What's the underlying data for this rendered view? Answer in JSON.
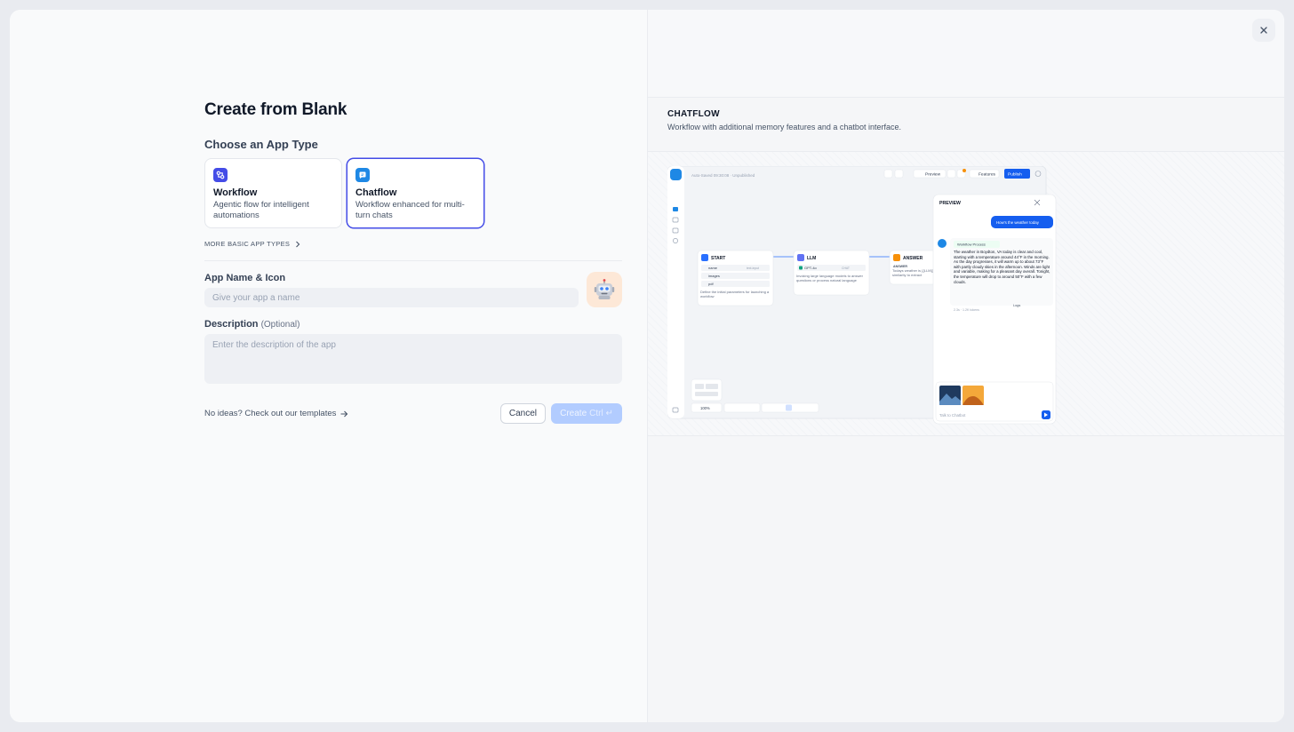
{
  "form": {
    "title": "Create from Blank",
    "app_type_label": "Choose an App Type",
    "types": [
      {
        "name": "Workflow",
        "desc": "Agentic flow for intelligent automations",
        "selected": false
      },
      {
        "name": "Chatflow",
        "desc": "Workflow enhanced for multi-turn chats",
        "selected": true
      }
    ],
    "more_types": "MORE BASIC APP TYPES",
    "name_label": "App Name & Icon",
    "name_placeholder": "Give your app a name",
    "app_icon": "🤖",
    "desc_label": "Description",
    "desc_optional": "(Optional)",
    "desc_placeholder": "Enter the description of the app",
    "templates_link": "No ideas? Check out our templates",
    "cancel_label": "Cancel",
    "create_label": "Create",
    "create_shortcut": "Ctrl ↵"
  },
  "preview": {
    "title": "CHATFLOW",
    "description": "Workflow with additional memory features and a chatbot interface.",
    "canvas": {
      "autosave": "Auto-Saved 09:30:08 · Unpublished",
      "preview_btn": "Preview",
      "features_btn": "Features",
      "publish_btn": "Publish",
      "zoom": "100%",
      "nodes": [
        {
          "title": "START",
          "rows": [
            "name",
            "images",
            "pdf"
          ],
          "row_tags": [
            "text-input"
          ],
          "desc": "Define the initial parameters for launching a workflow"
        },
        {
          "title": "LLM",
          "model": "GPT-4o",
          "model_tag": "CHAT",
          "desc": "Invoking large language models to answer questions or process natural language"
        },
        {
          "title": "ANSWER",
          "label": "ANSWER",
          "desc": "Todays weather is {{LLM}}, similarity to extract"
        }
      ],
      "chat": {
        "header": "PREVIEW",
        "user_msg": "How's the weather today",
        "process_tag": "Workflow Process",
        "bot_msg": "The weather in Boydton, VA today is clear and cool, starting with a temperature around 44°F in the morning. As the day progresses, it will warm up to about 73°F with partly cloudy skies in the afternoon. Winds are light and variable, making for a pleasant day overall. Tonight, the temperature will drop to around 50°F with a few clouds.",
        "meta": "2.3s · 1.2K tokens",
        "logs": "Logs",
        "input_placeholder": "Talk to Chatbot"
      }
    }
  },
  "colors": {
    "accent": "#444ce7",
    "chatflow_icon": "#1e88e5",
    "create_disabled": "#b2ccff"
  }
}
